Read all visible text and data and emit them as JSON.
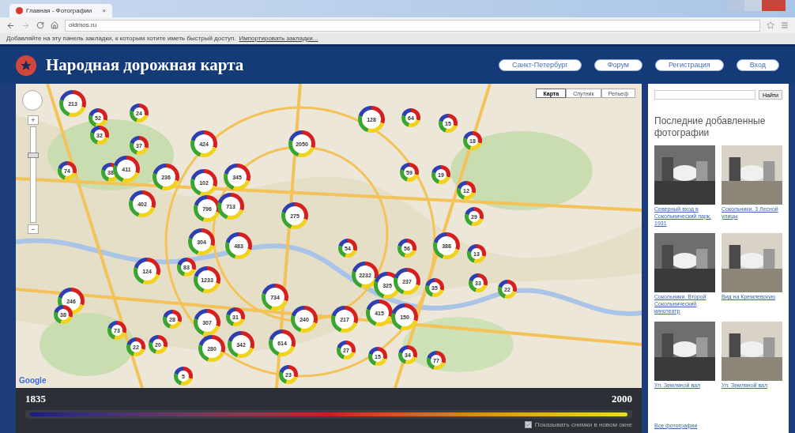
{
  "browser": {
    "tab": "Главная - Фотографии",
    "tab_close": "×",
    "url": "oldmos.ru",
    "bookmarks_bar": {
      "text": "Добавляйте на эту панель закладки, к которым хотите иметь быстрый доступ.",
      "link": "Импортировать закладки..."
    }
  },
  "header": {
    "title": "Народная дорожная карта",
    "nav": [
      "Санкт-Петербург",
      "Форум",
      "Регистрация",
      "Вход"
    ]
  },
  "map": {
    "kind": "picture",
    "map_types": [
      {
        "label": "Карта",
        "selected": true
      },
      {
        "label": "Спутник",
        "selected": false
      },
      {
        "label": "Рельеф",
        "selected": false
      }
    ],
    "zoom_in": "+",
    "zoom_out": "−",
    "zoom_level": {
      "level": 0.7
    },
    "logo": "Google",
    "clusters": [
      "213",
      "52",
      "24",
      "32",
      "37",
      "424",
      "2050",
      "128",
      "64",
      "15",
      "18",
      "74",
      "236",
      "102",
      "345",
      "38",
      "411",
      "402",
      "796",
      "713",
      "275",
      "59",
      "19",
      "12",
      "29",
      "304",
      "483",
      "54",
      "56",
      "388",
      "13",
      "124",
      "83",
      "1233",
      "734",
      "2232",
      "325",
      "237",
      "35",
      "246",
      "38",
      "73",
      "22",
      "20",
      "28",
      "307",
      "31",
      "280",
      "342",
      "614",
      "23",
      "240",
      "217",
      "415",
      "150",
      "27",
      "15",
      "34",
      "77",
      "5",
      "33",
      "22"
    ]
  },
  "timeline": {
    "start": "1835",
    "end": "2000",
    "range": {
      "level": 1
    },
    "option": {
      "label": "Показывать снимки в новом окне",
      "checked": true
    }
  },
  "sidebar": {
    "search_button": "Найти",
    "heading": "Последние добавленные фотографии",
    "photos": [
      {
        "caption": "Северный вход в Сокольнический парк, 1931"
      },
      {
        "caption": "Сокольники. 3 Лесной улицы"
      },
      {
        "caption": "Сокольники. Второй Сокольнический кинотеатр"
      },
      {
        "caption": "Вид на Кремлевскую"
      },
      {
        "caption": "Ул. Земляной вал"
      },
      {
        "caption": "Ул. Земляной вал"
      }
    ],
    "more_link": "Все фотографии"
  }
}
